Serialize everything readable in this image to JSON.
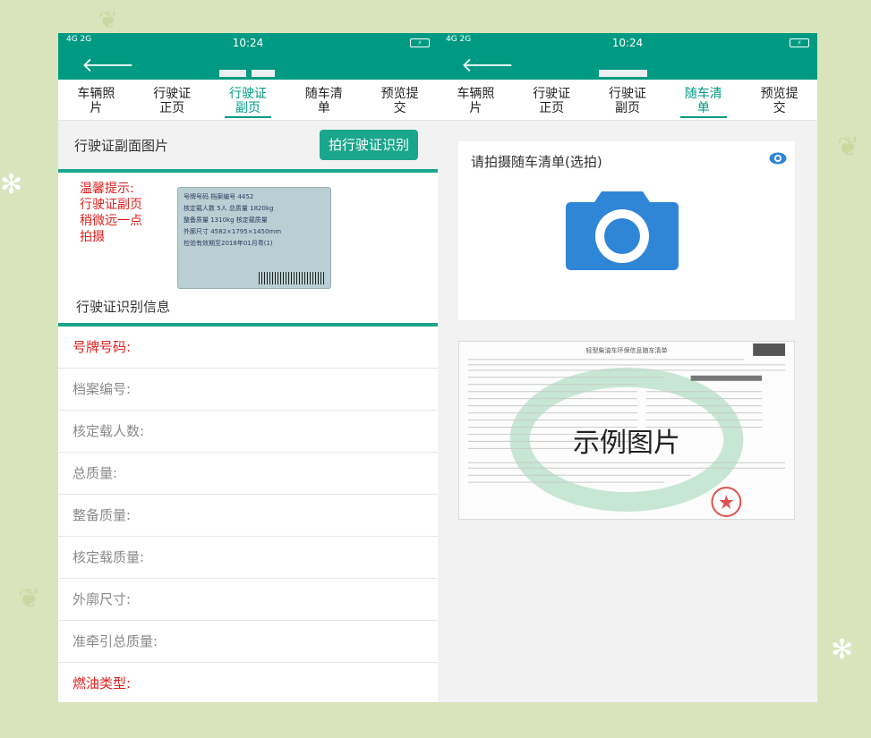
{
  "status_bar": {
    "signal": "4G 2G",
    "time": "10:24",
    "battery": "⚡"
  },
  "tabs": [
    {
      "line1": "车辆照",
      "line2": "片"
    },
    {
      "line1": "行驶证",
      "line2": "正页"
    },
    {
      "line1": "行驶证",
      "line2": "副页"
    },
    {
      "line1": "随车清",
      "line2": "单"
    },
    {
      "line1": "预览提",
      "line2": "交"
    }
  ],
  "left": {
    "active_tab": 2,
    "section_title": "行驶证副面图片",
    "recognize_button": "拍行驶证识别",
    "tip_lines": [
      "温馨提示:",
      " 行驶证副页",
      "稍微远一点",
      "拍摄"
    ],
    "license_lines": [
      "号牌号码    档案编号 4452",
      "核定载人数 5人   总质量 1820kg",
      "整备质量 1310kg   核定载质量",
      "外廓尺寸 4582×1795×1450mm",
      "检验有效期至2018年01月粤(1)"
    ],
    "info_title": "行驶证识别信息",
    "fields": [
      {
        "label": "号牌号码:",
        "required": true
      },
      {
        "label": "档案编号:",
        "required": false
      },
      {
        "label": "核定载人数:",
        "required": false
      },
      {
        "label": "总质量:",
        "required": false
      },
      {
        "label": "整备质量:",
        "required": false
      },
      {
        "label": "核定载质量:",
        "required": false
      },
      {
        "label": "外廓尺寸:",
        "required": false
      },
      {
        "label": "准牵引总质量:",
        "required": false
      },
      {
        "label": "燃油类型:",
        "required": true
      }
    ]
  },
  "right": {
    "active_tab": 3,
    "upload_label": "请拍摄随车清单(选拍)",
    "sample_title": "轻型柴油车环保信息随车清单",
    "sample_caption": "示例图片"
  },
  "colors": {
    "brand": "#009a82",
    "button": "#1aa68c",
    "camera": "#2f86d6",
    "required": "#e02020"
  },
  "icons": {
    "back": "back-arrow-icon",
    "eye": "eye-icon",
    "camera": "camera-icon"
  }
}
